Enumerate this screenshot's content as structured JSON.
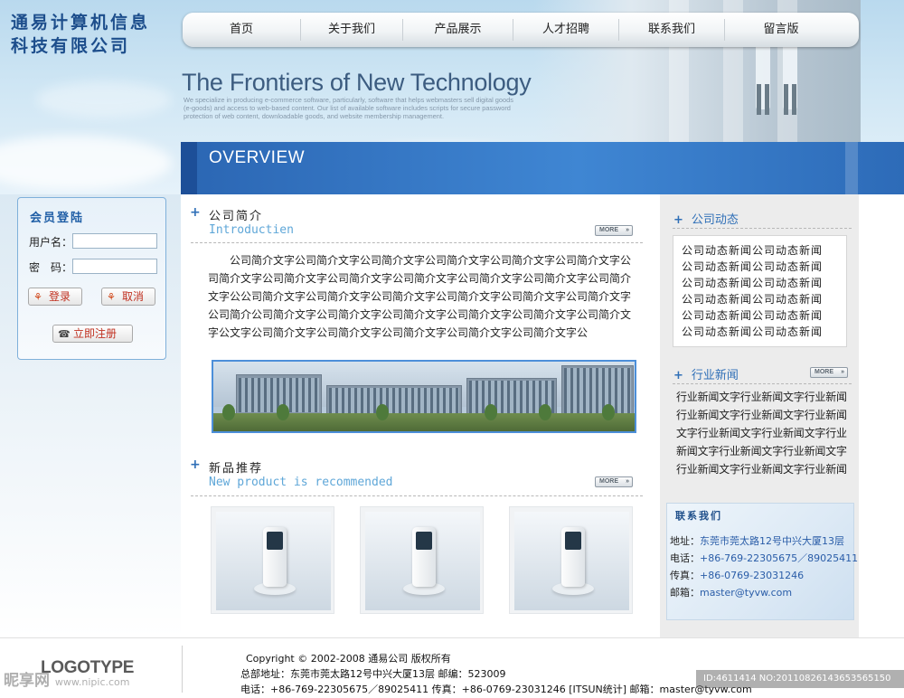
{
  "company_name": "通易计算机信息科技有限公司",
  "nav": [
    "首页",
    "关于我们",
    "产品展示",
    "人才招聘",
    "联系我们",
    "留言版"
  ],
  "banner": {
    "tagline": "The Frontiers of New Technology",
    "description": "We specialize in producing e-commerce software, particularly, software that helps webmasters sell digital goods (e-goods) and access to web-based content. Our list of available software includes scripts for secure password protection of web content, downloadable goods, and website membership management.",
    "overview": "OVERVIEW"
  },
  "login": {
    "title": "会员登陆",
    "username_label": "用户名：",
    "password_label": "密　码：",
    "login_button": "登录",
    "cancel_button": "取消",
    "register_button": "立即注册"
  },
  "intro": {
    "title_zh": "公司简介",
    "title_en": "Introductien",
    "more": "MORE",
    "body": "公司简介文字公司简介文字公司简介文字公司简介文字公司简介文字公司简介文字公司简介文字公司简介文字公司简介文字公司简介文字公司简介文字公司简介文字公司简介文字公公司简介文字公司简介文字公司简介文字公司简介文字公司简介文字公司简介文字公司简介公司简介文字公司简介文字公司简介文字公司简介文字公司简介文字公司简介文字公文字公司简介文字公司简介文字公司简介文字公司简介文字公司简介文字公"
  },
  "products": {
    "title_zh": "新品推荐",
    "title_en": "New product is recommended",
    "more": "MORE"
  },
  "company_news": {
    "title": "公司动态",
    "lines": [
      "公司动态新闻公司动态新闻",
      "公司动态新闻公司动态新闻",
      "公司动态新闻公司动态新闻",
      "公司动态新闻公司动态新闻",
      "公司动态新闻公司动态新闻",
      "公司动态新闻公司动态新闻"
    ]
  },
  "industry_news": {
    "title": "行业新闻",
    "more": "MORE",
    "lines": [
      "行业新闻文字行业新闻文字行业新闻",
      "行业新闻文字行业新闻文字行业新闻",
      "文字行业新闻文字行业新闻文字行业",
      "新闻文字行业新闻文字行业新闻文字",
      "行业新闻文字行业新闻文字行业新闻"
    ]
  },
  "contact": {
    "title": "联系我们",
    "address_label": "地址：",
    "address": "东莞市莞太路12号中兴大厦13层",
    "phone_label": "电话：",
    "phone": "+86-769-22305675／89025411",
    "fax_label": "传真：",
    "fax": "+86-0769-23031246",
    "email_label": "邮箱：",
    "email": "master@tyvw.com"
  },
  "footer": {
    "logo": "LOGOTYPE",
    "copyright": "Copyright © 2002-2008 通易公司 版权所有",
    "address_line": "总部地址：东莞市莞太路12号中兴大厦13层 邮编：523009",
    "contact_line": "电话：+86-769-22305675／89025411  传真：+86-0769-23031246 [ITSUN统计] 邮箱：master@tyvw.com"
  },
  "watermark": {
    "brand": "昵享网",
    "url": "www.nipic.com",
    "id": "ID:4611414 NO:20110826143653565150"
  }
}
